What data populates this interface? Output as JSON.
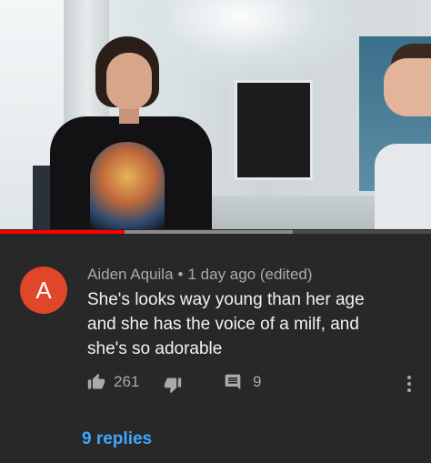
{
  "progress": {
    "played_fraction": 0.29,
    "buffered_fraction": 0.68
  },
  "comment": {
    "avatar_letter": "A",
    "avatar_color": "#e0462a",
    "author": "Aiden Aquila",
    "separator": "•",
    "time": "1 day ago (edited)",
    "text": "She's looks way young than her age and she has the voice of a milf, and she's so adorable",
    "like_count": "261",
    "reply_count": "9",
    "replies_link": "9 replies"
  },
  "icons": {
    "like": "thumbs-up-icon",
    "dislike": "thumbs-down-icon",
    "reply": "comment-icon",
    "more": "more-vertical-icon"
  },
  "colors": {
    "background": "#282828",
    "accent_link": "#3ea6ff",
    "progress_played": "#ff0000"
  }
}
